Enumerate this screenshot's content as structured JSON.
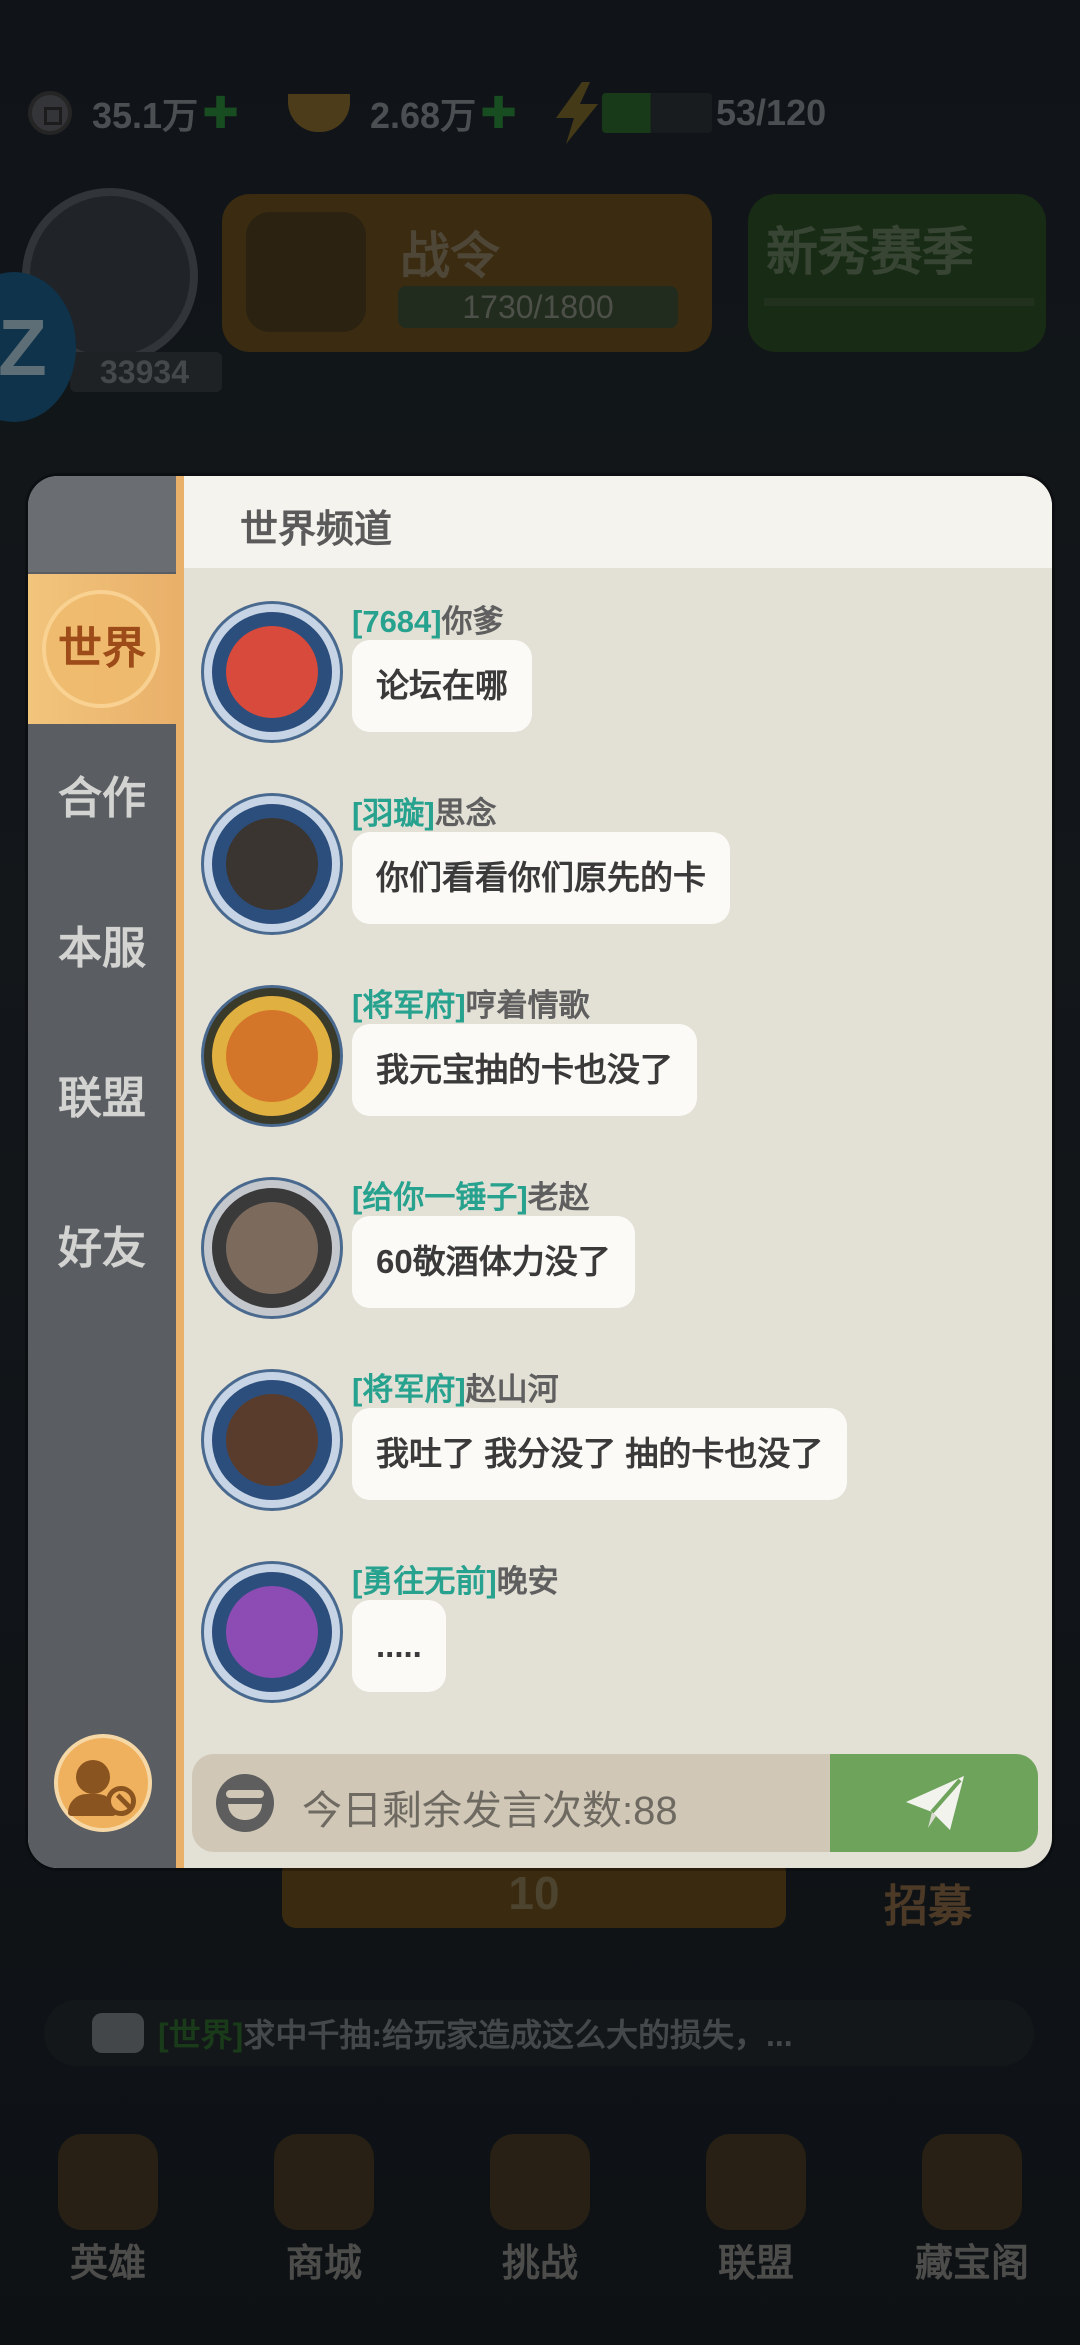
{
  "resources": {
    "coins": "35.1万",
    "ingots": "2.68万",
    "energy": "53/120",
    "energy_fraction": 0.44
  },
  "hud": {
    "power": "33934",
    "pass_title": "战令",
    "pass_progress": "1730/1800",
    "season_title": "新秀赛季",
    "recruit_cost": "10",
    "recruit_label": "招募",
    "side_badge": "Z"
  },
  "ticker": {
    "channel": "[世界]",
    "text": "求中千抽:给玩家造成这么大的损失，..."
  },
  "bottom_nav": [
    "英雄",
    "商城",
    "挑战",
    "联盟",
    "藏宝阁"
  ],
  "chat": {
    "title": "世界频道",
    "tabs": [
      "世界",
      "合作",
      "本服",
      "联盟",
      "好友"
    ],
    "active_tab": "世界",
    "messages": [
      {
        "guild": "[7684]",
        "user": "你爹",
        "text": "论坛在哪",
        "avatar_color": "#d84a3c"
      },
      {
        "guild": "[羽璇]",
        "user": "思念",
        "text": "你们看看你们原先的卡",
        "avatar_color": "#3a3530"
      },
      {
        "guild": "[将军府]",
        "user": "哼着情歌",
        "text": "我元宝抽的卡也没了",
        "avatar_color": "#d4762a"
      },
      {
        "guild": "[给你一锤子]",
        "user": "老赵",
        "text": "60敬酒体力没了",
        "avatar_color": "#7c6a5c"
      },
      {
        "guild": "[将军府]",
        "user": "赵山河",
        "text": "我吐了  我分没了 抽的卡也没了",
        "avatar_color": "#5a3c2c"
      },
      {
        "guild": "[勇往无前]",
        "user": "晚安",
        "text": ".....",
        "avatar_color": "#8c4cb4"
      }
    ],
    "input_placeholder": "今日剩余发言次数:88",
    "colors": {
      "guild": "#26a28e",
      "active_tab": "#e9b06a",
      "send": "#6ea35c"
    }
  }
}
